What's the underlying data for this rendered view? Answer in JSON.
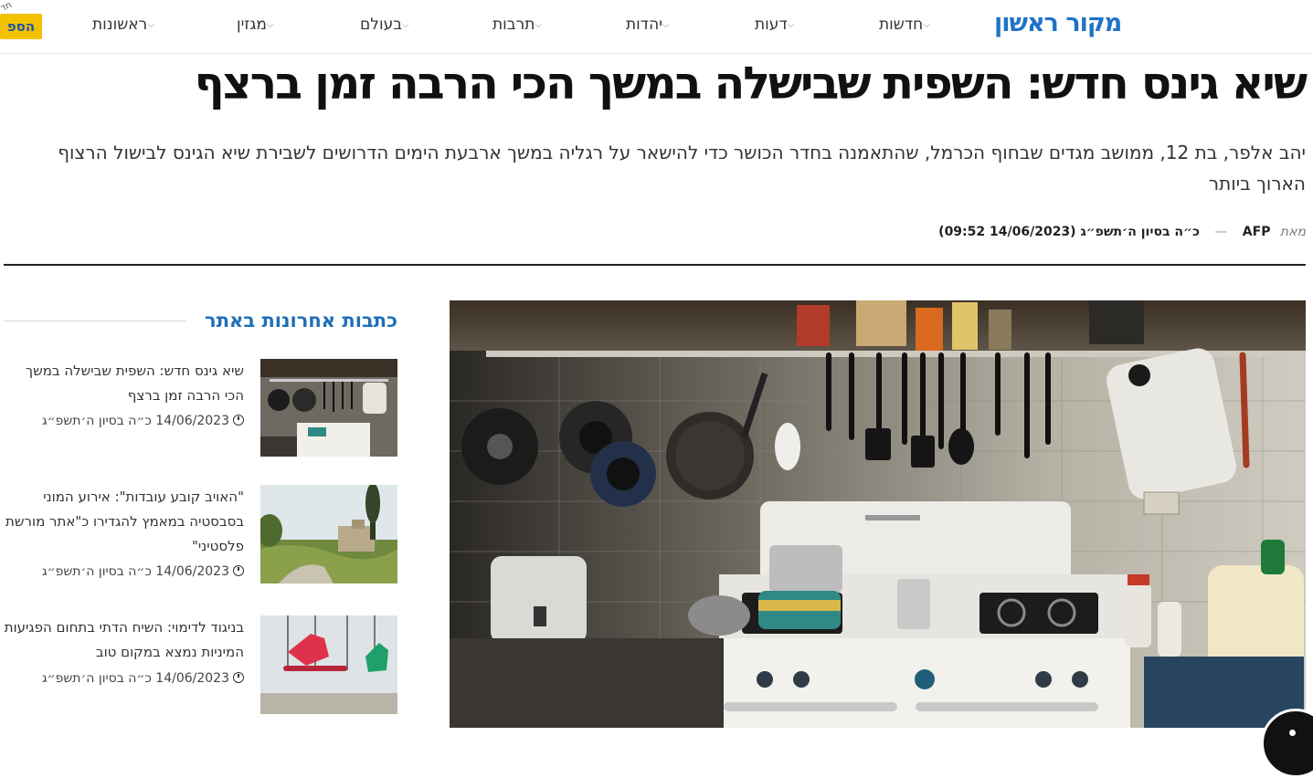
{
  "nav": {
    "logo": "מקור ראשון",
    "items": [
      {
        "label": "חדשות"
      },
      {
        "label": "דעות"
      },
      {
        "label": "יהדות"
      },
      {
        "label": "תרבות"
      },
      {
        "label": "בעולם"
      },
      {
        "label": "מגזין"
      },
      {
        "label": "ראשונות"
      }
    ],
    "badge": {
      "main": "הספ",
      "small": "חד"
    }
  },
  "article": {
    "title": "שיא גינס חדש: השפית שבישלה במשך הכי הרבה זמן ברצף",
    "subtitle": "יהב אלפר, בת 12, ממושב מגדים שבחוף הכרמל, שהתאמנה בחדר הכושר כדי להישאר על רגליה במשך ארבעת הימים הדרושים לשבירת שיא הגינס לבישול הרצוף הארוך ביותר",
    "by_prefix": "מאת",
    "author": "AFP",
    "separator": "—",
    "date": "כ״ה בסיון ה׳תשפ״ג (14/06/2023 09:52)"
  },
  "sidebar": {
    "title": "כתבות אחרונות באתר",
    "items": [
      {
        "title": "שיא גינס חדש: השפית שבישלה במשך הכי הרבה זמן ברצף",
        "date": "14/06/2023 כ״ה בסיון ה׳תשפ״ג"
      },
      {
        "title": "\"האויב קובע עובדות\": אירוע המוני בסבסטיה במאמץ להגדירו כ\"אתר מורשת פלסטיני\"",
        "date": "14/06/2023 כ״ה בסיון ה׳תשפ״ג"
      },
      {
        "title": "בניגוד לדימוי: השיח הדתי בתחום הפגיעות המיניות נמצא במקום טוב",
        "date": "14/06/2023 כ״ה בסיון ה׳תשפ״ג"
      }
    ]
  }
}
